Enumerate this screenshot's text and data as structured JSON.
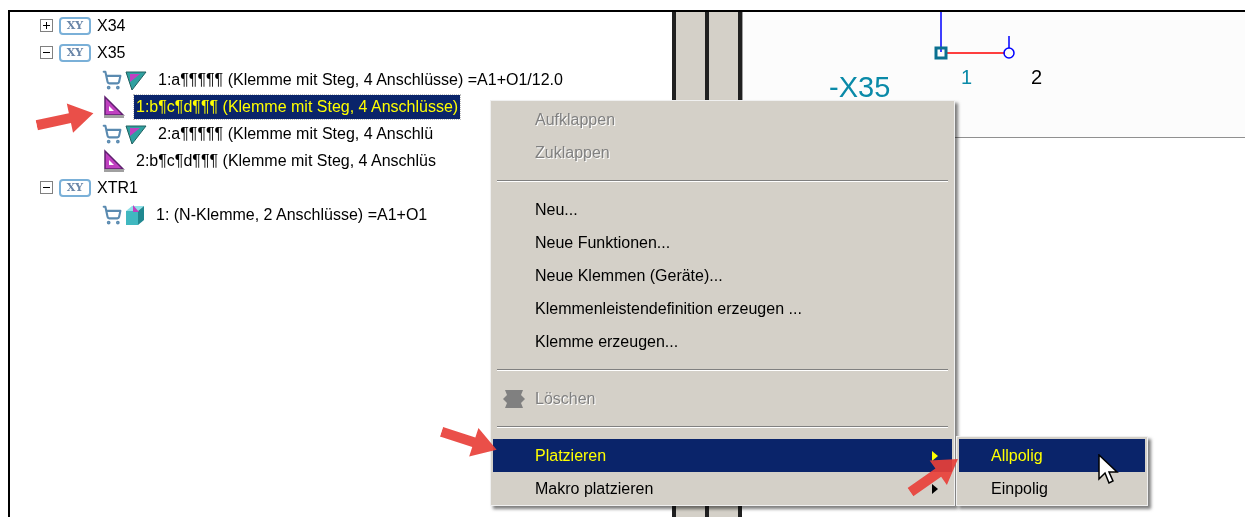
{
  "tree": [
    {
      "label": "X34",
      "icon_text": "XY",
      "expanded": false
    },
    {
      "label": "X35",
      "icon_text": "XY",
      "expanded": true,
      "children": [
        {
          "label": "1:a¶¶¶¶¶ (Klemme mit Steg, 4 Anschlüsse) =A1+O1/12.0",
          "kind": "cart_function",
          "selected": false
        },
        {
          "label": "1:b¶c¶d¶¶¶ (Klemme mit Steg, 4 Anschlüsse)",
          "kind": "function",
          "selected": true
        },
        {
          "label": "2:a¶¶¶¶¶ (Klemme mit Steg, 4 Anschlü",
          "kind": "cart_function",
          "selected": false
        },
        {
          "label": "2:b¶c¶d¶¶¶ (Klemme mit Steg, 4 Anschlüs",
          "kind": "function",
          "selected": false
        }
      ]
    },
    {
      "label": "XTR1",
      "icon_text": "XY",
      "expanded": true,
      "children": [
        {
          "label": "1: (N-Klemme, 2 Anschlüsse) =A1+O1",
          "kind": "cart_device",
          "selected": false
        }
      ]
    }
  ],
  "drawing": {
    "designation": "-X35",
    "pin_1": "1",
    "pin_2": "2"
  },
  "context_menu": [
    {
      "kind": "item",
      "label": "Aufklappen",
      "disabled": true,
      "selected": false
    },
    {
      "kind": "item",
      "label": "Zuklappen",
      "disabled": true,
      "selected": false
    },
    {
      "kind": "separator"
    },
    {
      "kind": "item",
      "label": "Neu...",
      "disabled": false,
      "selected": false
    },
    {
      "kind": "item",
      "label": "Neue Funktionen...",
      "disabled": false,
      "selected": false
    },
    {
      "kind": "item",
      "label": "Neue Klemmen (Geräte)...",
      "disabled": false,
      "selected": false
    },
    {
      "kind": "item",
      "label": "Klemmenleistendefinition erzeugen ...",
      "disabled": false,
      "selected": false
    },
    {
      "kind": "item",
      "label": "Klemme erzeugen...",
      "disabled": false,
      "selected": false
    },
    {
      "kind": "separator"
    },
    {
      "kind": "delete",
      "label": "Löschen",
      "disabled": true,
      "selected": false
    },
    {
      "kind": "separator"
    },
    {
      "kind": "submenu",
      "label": "Platzieren",
      "disabled": false,
      "selected": true
    },
    {
      "kind": "submenu",
      "label": "Makro platzieren",
      "disabled": false,
      "selected": false
    }
  ],
  "submenu": [
    {
      "label": "Allpolig",
      "selected": true
    },
    {
      "label": "Einpolig",
      "selected": false
    }
  ]
}
